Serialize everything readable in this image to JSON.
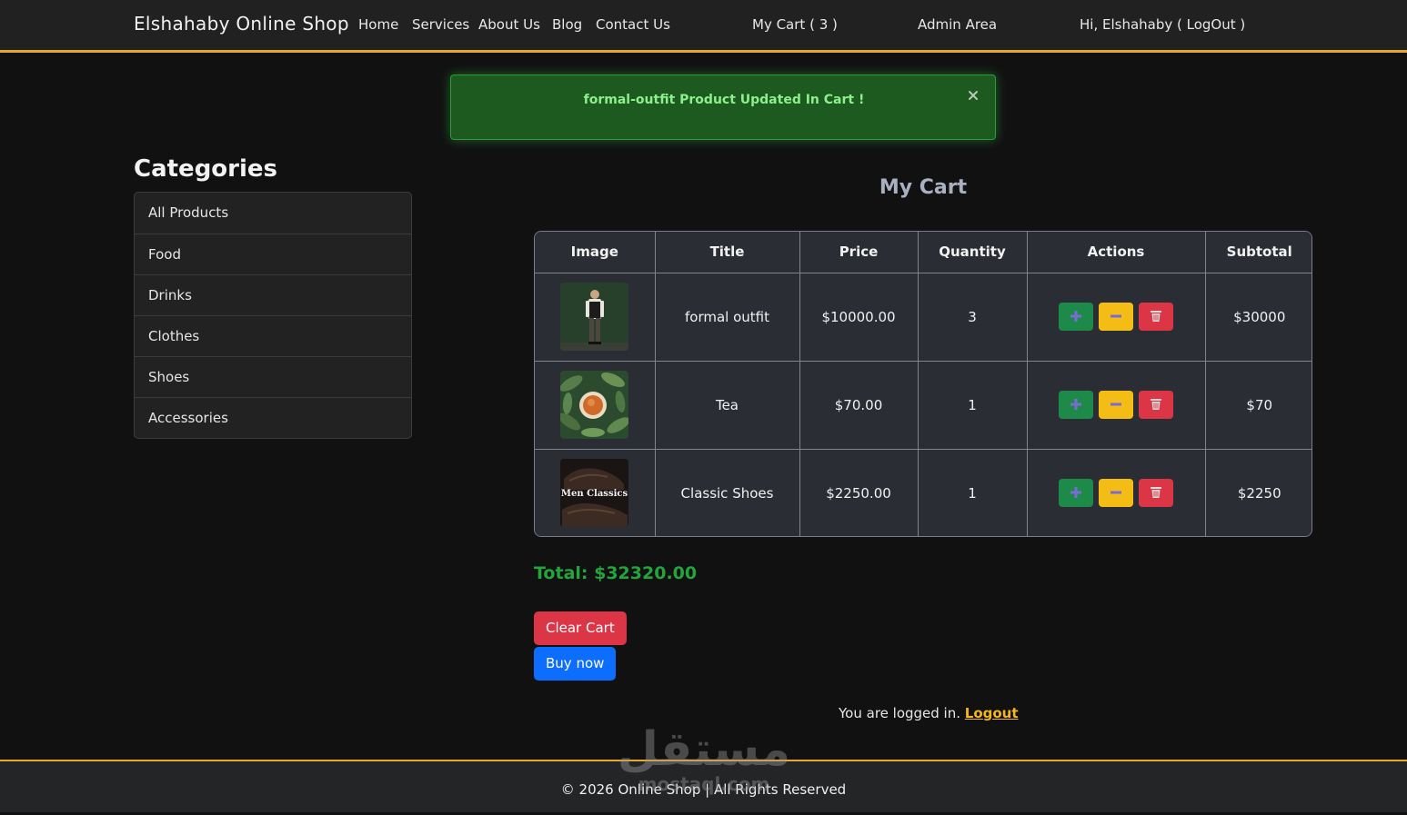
{
  "navbar": {
    "brand": "Elshahaby Online Shop",
    "links": [
      "Home",
      "Services",
      "About Us",
      "Blog",
      "Contact Us"
    ],
    "cart": "My Cart ( 3 )",
    "admin": "Admin Area",
    "user": "Hi, Elshahaby ( LogOut )"
  },
  "alert": {
    "message": "formal-outfit Product Updated In Cart !",
    "close_icon": "close-icon"
  },
  "sidebar": {
    "title": "Categories",
    "items": [
      "All Products",
      "Food",
      "Drinks",
      "Clothes",
      "Shoes",
      "Accessories"
    ]
  },
  "cart": {
    "title": "My Cart",
    "headers": [
      "Image",
      "Title",
      "Price",
      "Quantity",
      "Actions",
      "Subtotal"
    ],
    "rows": [
      {
        "image": "formal-outfit-photo",
        "title": "formal outfit",
        "price": "$10000.00",
        "quantity": "3",
        "subtotal": "$30000"
      },
      {
        "image": "tea-photo",
        "title": "Tea",
        "price": "$70.00",
        "quantity": "1",
        "subtotal": "$70"
      },
      {
        "image": "classic-shoes-photo",
        "image_text": "Men Classics",
        "title": "Classic Shoes",
        "price": "$2250.00",
        "quantity": "1",
        "subtotal": "$2250"
      }
    ],
    "actions": {
      "increase_icon": "plus-icon",
      "decrease_icon": "minus-icon",
      "delete_icon": "trash-icon"
    },
    "total": "Total: $32320.00",
    "clear_label": "Clear Cart",
    "buy_label": "Buy now"
  },
  "status": {
    "text": "You are logged in.",
    "link": "Logout"
  },
  "footer": {
    "text": "© 2026 Online Shop | All Rights Reserved",
    "watermark": "مستقل",
    "watermark_sub": "mostaql.com"
  },
  "colors": {
    "accent": "#e9a82b",
    "success": "#24a53c",
    "danger": "#dc3546",
    "primary": "#0d6efd",
    "warning": "#f4bd16"
  }
}
